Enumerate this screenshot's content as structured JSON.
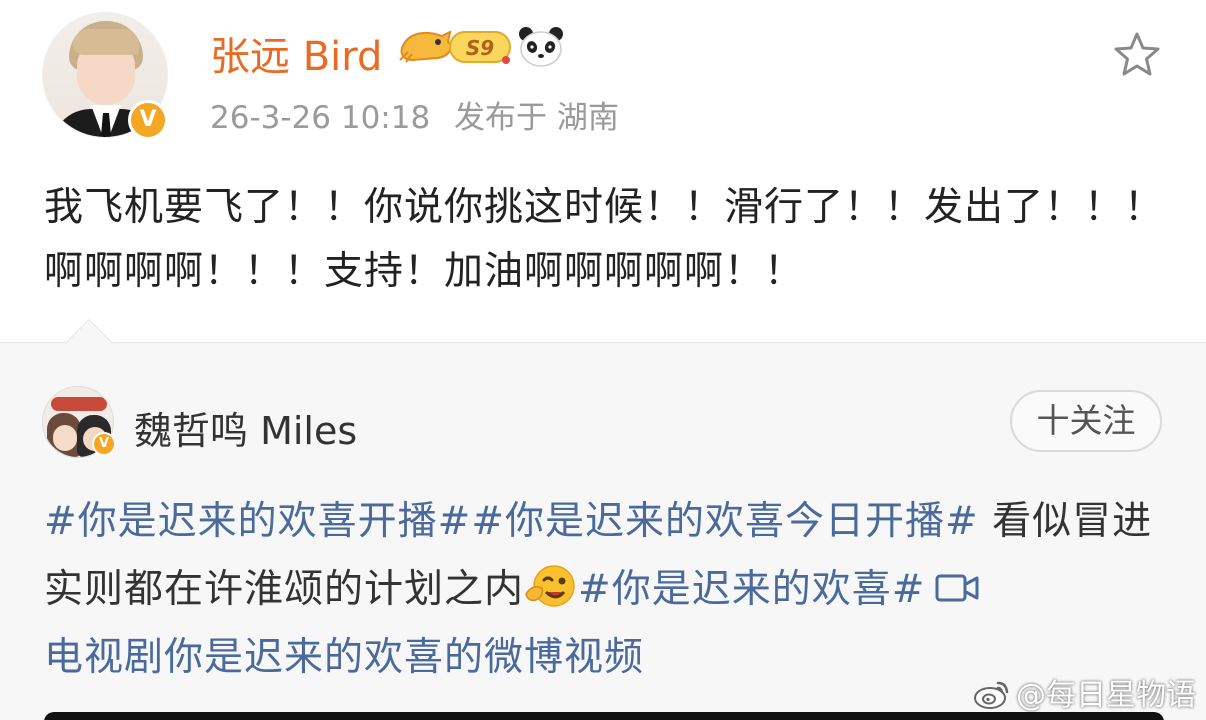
{
  "post": {
    "author": "张远 Bird",
    "level": "S9",
    "time": "26-3-26 10:18",
    "location": "发布于 湖南",
    "text": "我飞机要飞了！！你说你挑这时候！！滑行了！！发出了！！！啊啊啊啊！！！支持！加油啊啊啊啊啊！！",
    "verified_mark": "V"
  },
  "repost": {
    "author": "魏哲鸣 Miles",
    "follow_label": "十关注",
    "verified_mark": "V",
    "topic1": "#你是迟来的欢喜开播#",
    "topic2": "#你是迟来的欢喜今日开播#",
    "text1": " 看似冒进实则都在许淮颂的计划之内",
    "topic3": "#你是迟来的欢喜#",
    "video_link": "电视剧你是迟来的欢喜的微博视频"
  },
  "watermark": "@每日星物语",
  "colors": {
    "username": "#e86b25",
    "topic": "#4a6a9b",
    "verified": "#f5a623",
    "meta": "#9a9a9a"
  },
  "icons": {
    "favorite": "star-outline-icon",
    "badge": "panda-icon",
    "video": "video-camera-icon",
    "emoji": "winking-face-icon"
  }
}
